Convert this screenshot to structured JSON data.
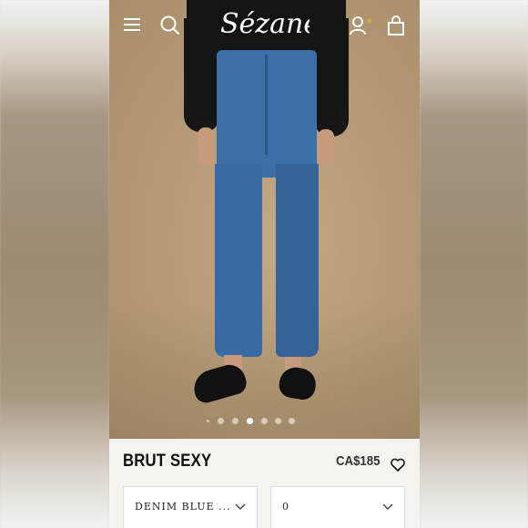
{
  "header": {
    "brand": "Sézane",
    "icons": [
      "menu-icon",
      "search-icon",
      "account-icon",
      "cart-icon"
    ],
    "cart_indicator_color": "#d8a33a"
  },
  "carousel": {
    "dot_count": 7,
    "active_index": 3
  },
  "product": {
    "name": "BRUT SEXY",
    "price": "CA$185",
    "wishlist_icon": "heart-icon"
  },
  "selectors": {
    "color_value": "DENIM BLUE ...",
    "size_value": "0"
  }
}
